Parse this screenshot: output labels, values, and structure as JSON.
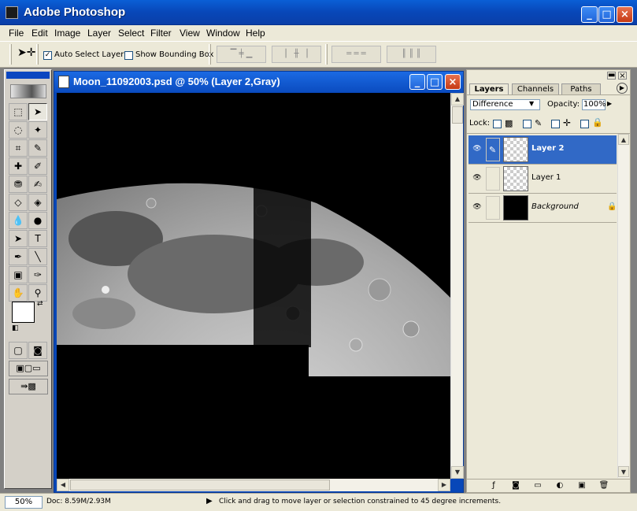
{
  "app": {
    "title": "Adobe Photoshop"
  },
  "window_controls": {
    "minimize": "_",
    "maximize": "□",
    "close": "×"
  },
  "menu": [
    "File",
    "Edit",
    "Image",
    "Layer",
    "Select",
    "Filter",
    "View",
    "Window",
    "Help"
  ],
  "options_bar": {
    "auto_select_label": "Auto Select Layer",
    "auto_select_checked": true,
    "show_bounding_label": "Show Bounding Box",
    "show_bounding_checked": false
  },
  "document": {
    "title": "Moon_11092003.psd @ 50% (Layer 2,Gray)"
  },
  "layers_panel": {
    "tabs": [
      "Layers",
      "Channels",
      "Paths"
    ],
    "blend_mode": "Difference",
    "opacity_label": "Opacity:",
    "opacity_value": "100%",
    "lock_label": "Lock:",
    "layers": [
      {
        "name": "Layer 2",
        "selected": true
      },
      {
        "name": "Layer 1",
        "selected": false
      },
      {
        "name": "Background",
        "selected": false,
        "locked": true
      }
    ]
  },
  "status_bar": {
    "zoom": "50%",
    "doc_info": "Doc: 8.59M/2.93M",
    "hint": "Click and drag to move layer or selection constrained to 45 degree increments."
  },
  "icons": [
    "photoshop-icon",
    "move-icon",
    "eye-icon",
    "brush-icon",
    "lock-icon",
    "trash-icon",
    "new-layer-icon",
    "folder-icon",
    "mask-icon",
    "effects-icon",
    "adjustment-icon"
  ]
}
